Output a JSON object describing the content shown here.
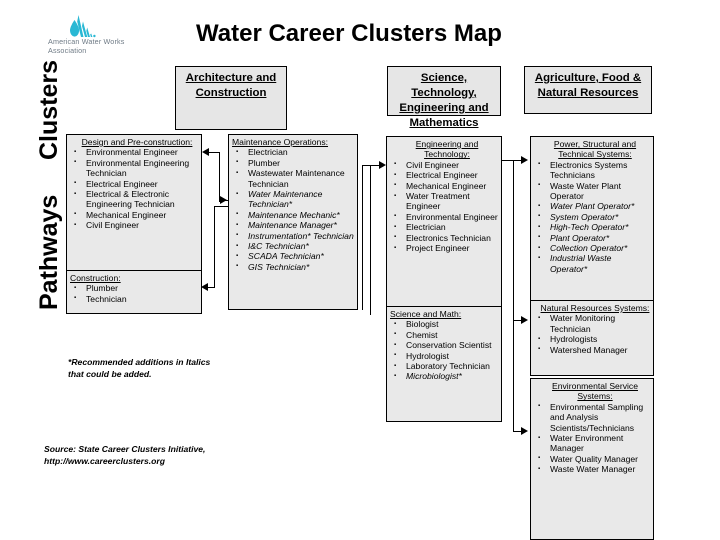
{
  "logo": {
    "name": "American Water Works Association",
    "line1": "American Water Works",
    "line2": "Association",
    "color": "#29b8d4"
  },
  "header": {
    "title": "Water Career Clusters Map"
  },
  "axis": {
    "clusters_label": "Clusters",
    "pathways_label": "Pathways"
  },
  "clusters": [
    {
      "id": "architecture-and-construction",
      "label": "Architecture and Construction"
    },
    {
      "id": "science-technology-engineering-and-mathematics",
      "label": "Science, Technology, Engineering and Mathematics"
    },
    {
      "id": "agriculture-food-and-natural-resources",
      "label": "Agriculture, Food & Natural Resources"
    }
  ],
  "pathways": [
    {
      "id": "design-and-pre-construction",
      "heading": "Design and Pre-construction:",
      "items": [
        {
          "text": "Environmental Engineer",
          "italic": false
        },
        {
          "text": "Environmental Engineering Technician",
          "italic": false
        },
        {
          "text": "Electrical Engineer",
          "italic": false
        },
        {
          "text": "Electrical & Electronic Engineering Technician",
          "italic": false
        },
        {
          "text": "Mechanical Engineer",
          "italic": false
        },
        {
          "text": "Civil Engineer",
          "italic": false
        }
      ]
    },
    {
      "id": "construction",
      "heading": "Construction:",
      "items": [
        {
          "text": "Plumber",
          "italic": false
        },
        {
          "text": "Technician",
          "italic": false
        }
      ]
    },
    {
      "id": "maintenance-operations",
      "heading": "Maintenance Operations:",
      "items": [
        {
          "text": "Electrician",
          "italic": false
        },
        {
          "text": "Plumber",
          "italic": false
        },
        {
          "text": "Wastewater Maintenance Technician",
          "italic": false
        },
        {
          "text": "Water Maintenance Technician*",
          "italic": true
        },
        {
          "text": "Maintenance Mechanic*",
          "italic": true
        },
        {
          "text": "Maintenance Manager*",
          "italic": true
        },
        {
          "text": "Instrumentation* Technician",
          "italic": true
        },
        {
          "text": "I&C Technician*",
          "italic": true
        },
        {
          "text": "SCADA Technician*",
          "italic": true
        },
        {
          "text": "GIS Technician*",
          "italic": true
        }
      ]
    },
    {
      "id": "engineering-and-technology",
      "heading": "Engineering and Technology:",
      "items": [
        {
          "text": "Civil Engineer",
          "italic": false
        },
        {
          "text": "Electrical Engineer",
          "italic": false
        },
        {
          "text": "Mechanical Engineer",
          "italic": false
        },
        {
          "text": "Water Treatment Engineer",
          "italic": false
        },
        {
          "text": "Environmental Engineer",
          "italic": false
        },
        {
          "text": "Electrician",
          "italic": false
        },
        {
          "text": "Electronics Technician",
          "italic": false
        },
        {
          "text": "Project Engineer",
          "italic": false
        }
      ]
    },
    {
      "id": "science-and-math",
      "heading": "Science and Math:",
      "items": [
        {
          "text": "Biologist",
          "italic": false
        },
        {
          "text": "Chemist",
          "italic": false
        },
        {
          "text": "Conservation Scientist",
          "italic": false
        },
        {
          "text": "Hydrologist",
          "italic": false
        },
        {
          "text": "Laboratory Technician",
          "italic": false
        },
        {
          "text": "Microbiologist*",
          "italic": true
        }
      ]
    },
    {
      "id": "power-structural-and-technical-systems",
      "heading": "Power, Structural and Technical Systems:",
      "items": [
        {
          "text": "Electronics Systems Technicians",
          "italic": false
        },
        {
          "text": "Waste Water Plant Operator",
          "italic": false
        },
        {
          "text": "Water Plant Operator*",
          "italic": true
        },
        {
          "text": "System Operator*",
          "italic": true
        },
        {
          "text": "High-Tech Operator*",
          "italic": true
        },
        {
          "text": "Plant Operator*",
          "italic": true
        },
        {
          "text": "Collection Operator*",
          "italic": true
        },
        {
          "text": "Industrial Waste Operator*",
          "italic": true
        }
      ]
    },
    {
      "id": "natural-resources-systems",
      "heading": "Natural Resources Systems:",
      "items": [
        {
          "text": "Water Monitoring Technician",
          "italic": false
        },
        {
          "text": "Hydrologists",
          "italic": false
        },
        {
          "text": "Watershed Manager",
          "italic": false
        }
      ]
    },
    {
      "id": "environmental-service-systems",
      "heading": "Environmental Service Systems:",
      "items": [
        {
          "text": "Environmental Sampling and Analysis Scientists/Technicians",
          "italic": false
        },
        {
          "text": "Water Environment Manager",
          "italic": false
        },
        {
          "text": "Water Quality Manager",
          "italic": false
        },
        {
          "text": "Waste Water Manager",
          "italic": false
        }
      ]
    }
  ],
  "notes": {
    "recommended": "*Recommended additions in Italics that could be added.",
    "source": "Source:  State Career Clusters Initiative, http://www.careerclusters.org"
  }
}
